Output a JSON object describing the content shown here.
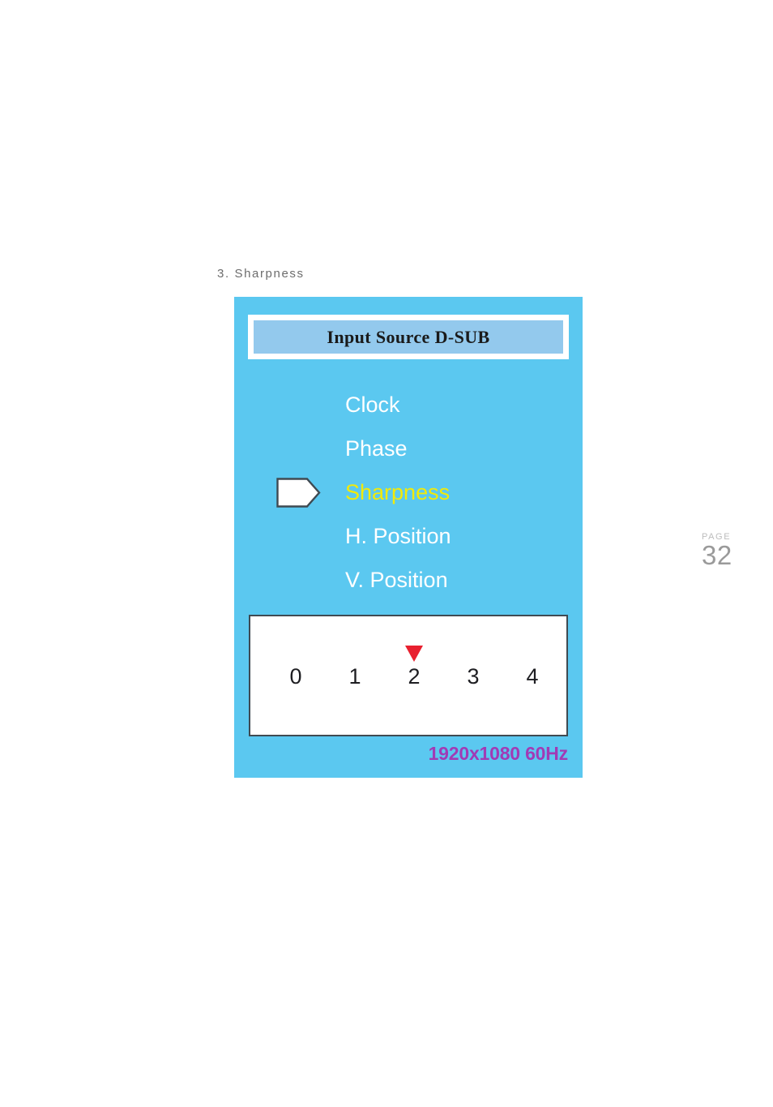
{
  "figure": {
    "caption": "3. Sharpness"
  },
  "osd": {
    "title": "Input Source D-SUB",
    "menu_items": [
      {
        "label": "Clock",
        "selected": false
      },
      {
        "label": "Phase",
        "selected": false
      },
      {
        "label": "Sharpness",
        "selected": true
      },
      {
        "label": "H. Position",
        "selected": false
      },
      {
        "label": "V. Position",
        "selected": false
      }
    ],
    "value_scale": {
      "ticks": [
        "0",
        "1",
        "2",
        "3",
        "4"
      ],
      "current_value": "2",
      "marker_index": 2
    },
    "resolution": "1920x1080 60Hz",
    "colors": {
      "screen_background": "#5BC8F0",
      "titlebar_fill": "#93C9ED",
      "titlebar_frame": "#FFFFFF",
      "menu_text": "#FFFFFF",
      "menu_selected_text": "#F2EA09",
      "marker": "#E8202F",
      "resolution_text": "#A13BB5",
      "panel_border": "#3F4A52"
    }
  },
  "page_marker": {
    "word": "PAGE",
    "number": "32"
  }
}
